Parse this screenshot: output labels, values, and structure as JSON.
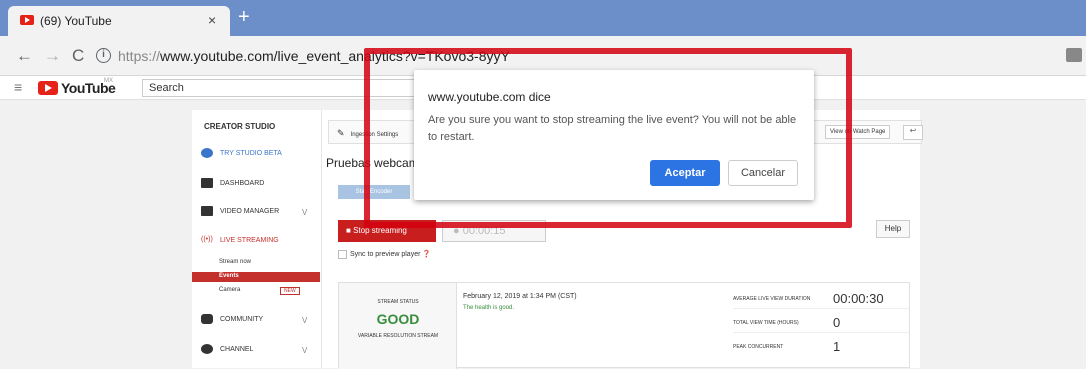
{
  "browser": {
    "tab_title": "(69) YouTube",
    "tab_close": "×",
    "new_tab": "+",
    "back": "←",
    "forward": "→",
    "reload": "C",
    "url_scheme": "https://",
    "url_rest": "www.youtube.com/live_event_analytics?v=TKovo3-8yyY"
  },
  "ytheader": {
    "menu": "≡",
    "logo_text": "YouTube",
    "region": "MX",
    "search_placeholder": "Search"
  },
  "sidebar": {
    "title": "CREATOR STUDIO",
    "items": [
      {
        "label": "TRY STUDIO BETA"
      },
      {
        "label": "DASHBOARD"
      },
      {
        "label": "VIDEO MANAGER",
        "chevron": "v"
      },
      {
        "label": "LIVE STREAMING"
      },
      {
        "label": "COMMUNITY",
        "chevron": "v"
      },
      {
        "label": "CHANNEL",
        "chevron": "v"
      }
    ],
    "sub": {
      "stream_now": "Stream now",
      "events": "Events",
      "camera": "Camera",
      "new_badge": "NEW"
    }
  },
  "main": {
    "ingestion": "Ingestion Settings",
    "view_watch": "View on Watch Page",
    "event_title": "Pruebas webcam",
    "start_encoder": "Start Encoder",
    "stop_streaming": "Stop streaming",
    "elapsed": "00:00:15",
    "help": "Help",
    "sync": "Sync to preview player"
  },
  "status": {
    "label": "STREAM STATUS",
    "value": "GOOD",
    "sub": "VARIABLE RESOLUTION STREAM",
    "date": "February 12, 2019 at 1:34 PM (CST)",
    "health": "The health is good.",
    "metrics": [
      {
        "label": "AVERAGE LIVE VIEW DURATION",
        "value": "00:00:30"
      },
      {
        "label": "TOTAL VIEW TIME (HOURS)",
        "value": "0"
      },
      {
        "label": "PEAK CONCURRENT",
        "value": "1"
      }
    ]
  },
  "dialog": {
    "title": "www.youtube.com dice",
    "message": "Are you sure you want to stop streaming the live event? You will not be able to restart.",
    "ok": "Aceptar",
    "cancel": "Cancelar"
  },
  "colors": {
    "accent": "#2c74e3",
    "highlight": "#d4000f",
    "youtube_red": "#e62117",
    "good": "#388e3c"
  }
}
